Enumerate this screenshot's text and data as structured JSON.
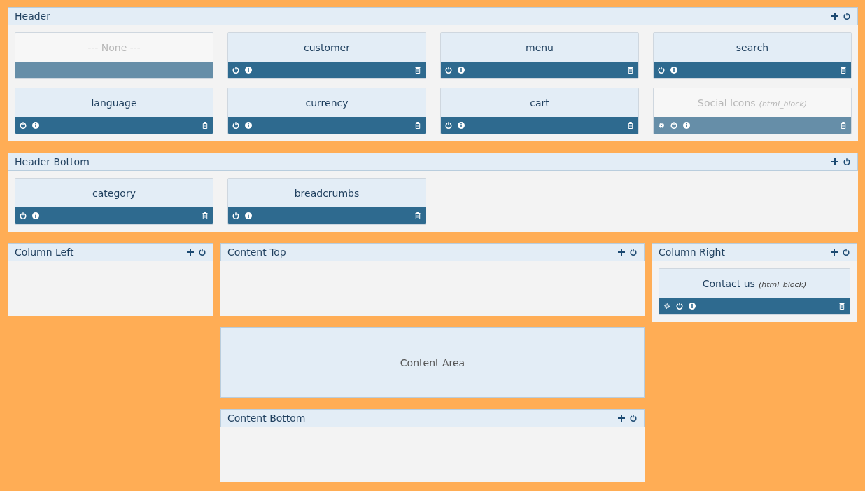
{
  "header": {
    "title": "Header",
    "modules": [
      {
        "kind": "empty",
        "name": "--- None ---",
        "disabled": true
      },
      {
        "kind": "module",
        "name": "customer",
        "disabled": false,
        "settings": false
      },
      {
        "kind": "module",
        "name": "menu",
        "disabled": false,
        "settings": false
      },
      {
        "kind": "module",
        "name": "search",
        "disabled": false,
        "settings": false
      },
      {
        "kind": "module",
        "name": "language",
        "disabled": false,
        "settings": false
      },
      {
        "kind": "module",
        "name": "currency",
        "disabled": false,
        "settings": false
      },
      {
        "kind": "module",
        "name": "cart",
        "disabled": false,
        "settings": false
      },
      {
        "kind": "module",
        "name": "Social Icons",
        "note": "(html_block)",
        "disabled": true,
        "settings": true
      }
    ]
  },
  "header_bottom": {
    "title": "Header Bottom",
    "modules": [
      {
        "kind": "module",
        "name": "category",
        "disabled": false,
        "settings": false
      },
      {
        "kind": "module",
        "name": "breadcrumbs",
        "disabled": false,
        "settings": false
      }
    ]
  },
  "column_left": {
    "title": "Column Left"
  },
  "content_top": {
    "title": "Content Top"
  },
  "content_area": {
    "label": "Content Area"
  },
  "content_bottom": {
    "title": "Content Bottom"
  },
  "column_right": {
    "title": "Column Right",
    "modules": [
      {
        "kind": "module",
        "name": "Contact us",
        "note": "(html_block)",
        "disabled": false,
        "settings": true
      }
    ]
  }
}
